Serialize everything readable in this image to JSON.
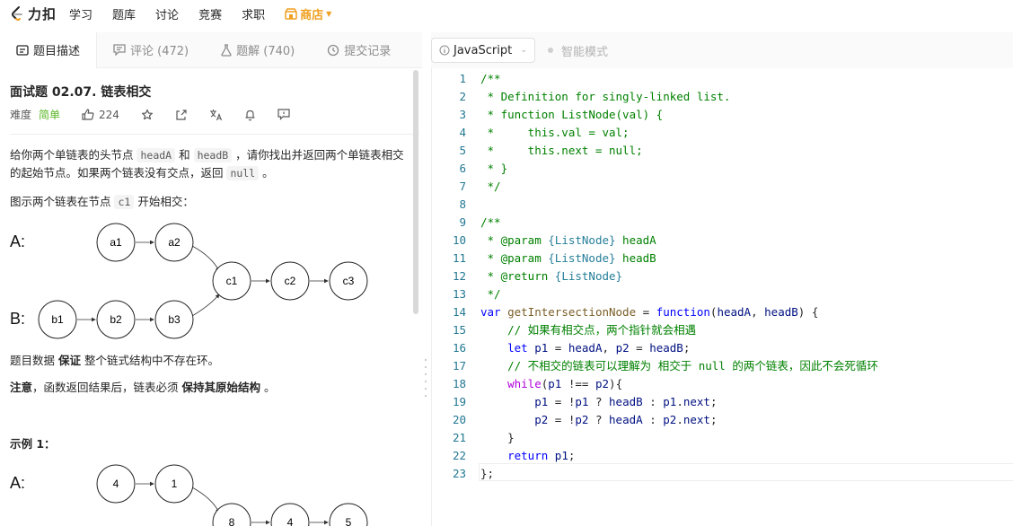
{
  "nav": {
    "logo": "力扣",
    "items": [
      "学习",
      "题库",
      "讨论",
      "竞赛",
      "求职"
    ],
    "store": "商店"
  },
  "left_tabs": [
    {
      "label": "题目描述",
      "icon": "description-icon"
    },
    {
      "label": "评论 (472)",
      "icon": "comment-icon"
    },
    {
      "label": "题解 (740)",
      "icon": "flask-icon"
    },
    {
      "label": "提交记录",
      "icon": "clock-icon"
    }
  ],
  "editor_toolbar": {
    "language": "JavaScript",
    "smart_mode": "智能模式"
  },
  "problem": {
    "title": "面试题 02.07. 链表相交",
    "difficulty_label": "难度",
    "difficulty": "简单",
    "likes": "224",
    "desc1_a": "给你两个单链表的头节点 ",
    "desc1_code1": "headA",
    "desc1_b": " 和 ",
    "desc1_code2": "headB",
    "desc1_c": " ，请你找出并返回两个单链表相交的起始节点。如果两个链表没有交点，返回 ",
    "desc1_code3": "null",
    "desc1_d": " 。",
    "desc2_a": "图示两个链表在节点 ",
    "desc2_code": "c1",
    "desc2_b": " 开始相交：",
    "diagram1": {
      "row_a_label": "A:",
      "row_b_label": "B:",
      "a_nodes": [
        "a1",
        "a2"
      ],
      "b_nodes": [
        "b1",
        "b2",
        "b3"
      ],
      "c_nodes": [
        "c1",
        "c2",
        "c3"
      ]
    },
    "desc3_a": "题目数据 ",
    "desc3_b": "保证",
    "desc3_c": " 整个链式结构中不存在环。",
    "desc4_a": "注意",
    "desc4_b": "，函数返回结果后，链表必须 ",
    "desc4_c": "保持其原始结构",
    "desc4_d": " 。",
    "example_title": "示例 1：",
    "diagram2": {
      "row_a_label": "A:",
      "a_nodes": [
        "4",
        "1"
      ],
      "c_nodes": [
        "8",
        "4",
        "5"
      ]
    }
  },
  "code_lines": [
    {
      "n": "1",
      "t": "/**"
    },
    {
      "n": "2",
      "t": " * Definition for singly-linked list."
    },
    {
      "n": "3",
      "t": " * function ListNode(val) {"
    },
    {
      "n": "4",
      "t": " *     this.val = val;"
    },
    {
      "n": "5",
      "t": " *     this.next = null;"
    },
    {
      "n": "6",
      "t": " * }"
    },
    {
      "n": "7",
      "t": " */"
    },
    {
      "n": "8",
      "t": ""
    },
    {
      "n": "9",
      "t": "/**"
    },
    {
      "n": "10",
      "t": " * @param {ListNode} headA"
    },
    {
      "n": "11",
      "t": " * @param {ListNode} headB"
    },
    {
      "n": "12",
      "t": " * @return {ListNode}"
    },
    {
      "n": "13",
      "t": " */"
    },
    {
      "n": "14",
      "t": "var getIntersectionNode = function(headA, headB) {"
    },
    {
      "n": "15",
      "t": "    // 如果有相交点，两个指针就会相遇"
    },
    {
      "n": "16",
      "t": "    let p1 = headA, p2 = headB;"
    },
    {
      "n": "17",
      "t": "    // 不相交的链表可以理解为 相交于 null 的两个链表，因此不会死循环"
    },
    {
      "n": "18",
      "t": "    while(p1 !== p2){"
    },
    {
      "n": "19",
      "t": "        p1 = !p1 ? headB : p1.next;"
    },
    {
      "n": "20",
      "t": "        p2 = !p2 ? headA : p2.next;"
    },
    {
      "n": "21",
      "t": "    }"
    },
    {
      "n": "22",
      "t": "    return p1;"
    },
    {
      "n": "23",
      "t": "};"
    }
  ],
  "colors": {
    "accent": "#f0a020",
    "easy": "#5ab726",
    "comment": "#008000",
    "keyword": "#0000ff",
    "line_number": "#237893"
  }
}
